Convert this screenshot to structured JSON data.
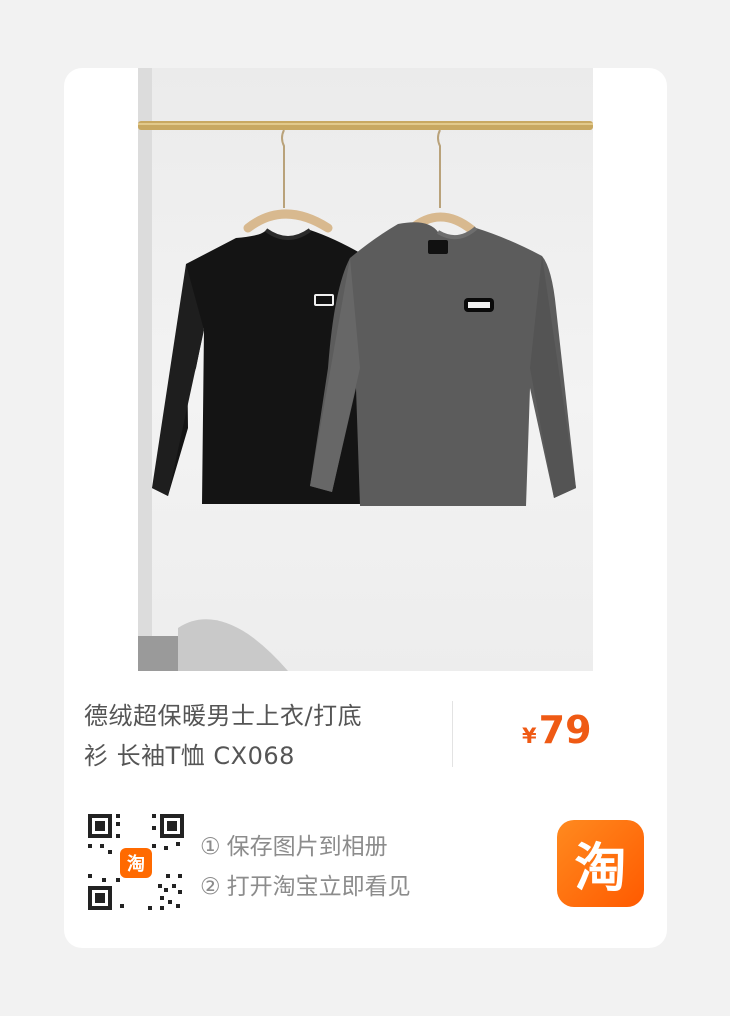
{
  "product": {
    "title_line1": "德绒超保暖男士上衣/打底",
    "title_line2": "衫 长袖T恤 CX068",
    "price_currency": "¥",
    "price_value": "79"
  },
  "qr": {
    "center_logo": "淘"
  },
  "instructions": [
    {
      "num": "①",
      "text": "保存图片到相册"
    },
    {
      "num": "②",
      "text": "打开淘宝立即看见"
    }
  ],
  "app_logo": {
    "glyph": "淘",
    "icon": "taobao-app-icon"
  },
  "colors": {
    "accent": "#ef5a14",
    "logo_orange": "#ff6a00"
  }
}
